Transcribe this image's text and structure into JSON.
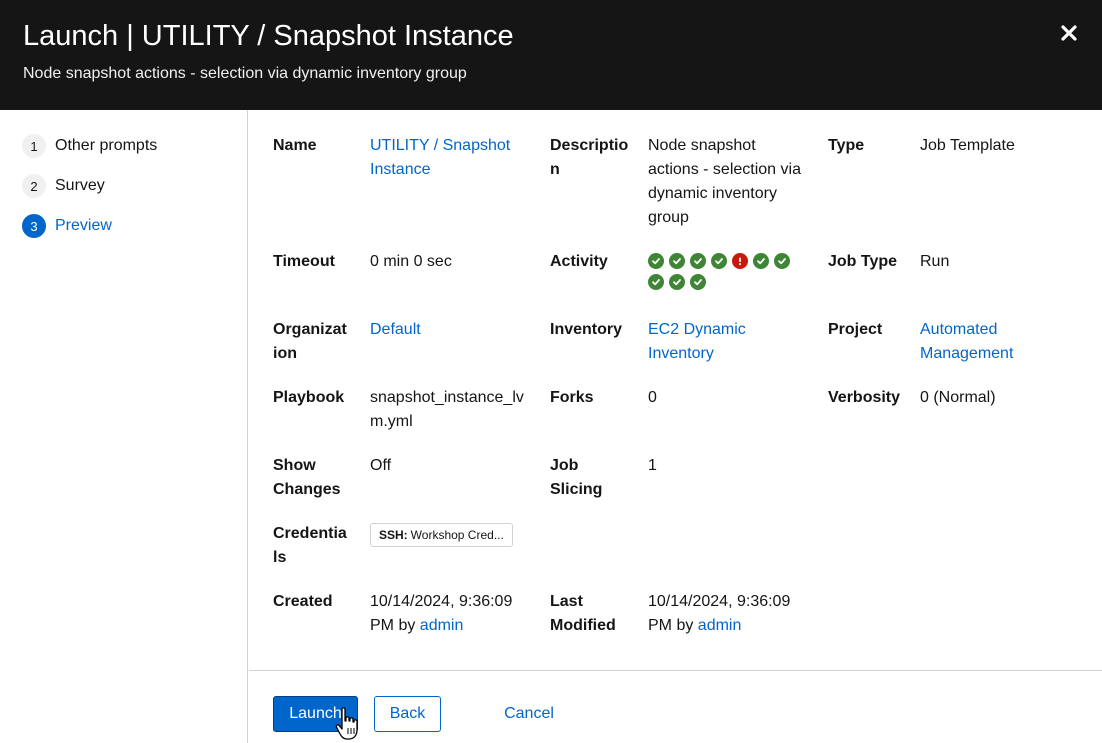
{
  "modal": {
    "title": "Launch | UTILITY / Snapshot Instance",
    "subtitle": "Node snapshot actions - selection via dynamic inventory group",
    "close_icon": "close-icon"
  },
  "steps": [
    {
      "num": "1",
      "label": "Other prompts"
    },
    {
      "num": "2",
      "label": "Survey"
    },
    {
      "num": "3",
      "label": "Preview"
    }
  ],
  "details": {
    "name_label": "Name",
    "name_line1": "UTILITY / Snapshot",
    "name_line2": "Instance",
    "description_label_1": "Descriptio",
    "description_label_2": "n",
    "description_lines": [
      "Node snapshot",
      "actions - selection via",
      "dynamic inventory",
      "group"
    ],
    "type_label": "Type",
    "type_value": "Job Template",
    "timeout_label": "Timeout",
    "timeout_value": "0 min 0 sec",
    "activity_label": "Activity",
    "activity": [
      "success",
      "success",
      "success",
      "success",
      "failed",
      "success",
      "success",
      "success",
      "success",
      "success"
    ],
    "job_type_label": "Job Type",
    "job_type_value": "Run",
    "organization_label_1": "Organizat",
    "organization_label_2": "ion",
    "organization_value": "Default",
    "inventory_label": "Inventory",
    "inventory_line1": "EC2 Dynamic",
    "inventory_line2": "Inventory",
    "project_label": "Project",
    "project_line1": "Automated",
    "project_line2": "Management",
    "playbook_label": "Playbook",
    "playbook_line1": "snapshot_instance_lv",
    "playbook_line2": "m.yml",
    "forks_label": "Forks",
    "forks_value": "0",
    "verbosity_label": "Verbosity",
    "verbosity_value": "0 (Normal)",
    "show_changes_label_1": "Show",
    "show_changes_label_2": "Changes",
    "show_changes_value": "Off",
    "job_slicing_label_1": "Job",
    "job_slicing_label_2": "Slicing",
    "job_slicing_value": "1",
    "credentials_label_1": "Credentia",
    "credentials_label_2": "ls",
    "credential_kind": "SSH:",
    "credential_name": "Workshop Cred...",
    "created_label": "Created",
    "created_date": "10/14/2024, 9:36:09",
    "created_by_prefix": "PM by",
    "created_by_user": "admin",
    "modified_label_1": "Last",
    "modified_label_2": "Modified",
    "modified_date": "10/14/2024, 9:36:09",
    "modified_by_prefix": "PM by",
    "modified_by_user": "admin"
  },
  "footer": {
    "launch_label": "Launch",
    "back_label": "Back",
    "cancel_label": "Cancel"
  },
  "colors": {
    "header_bg": "#151515",
    "accent": "#0066cc",
    "success": "#3e8635",
    "danger": "#c9190b"
  }
}
